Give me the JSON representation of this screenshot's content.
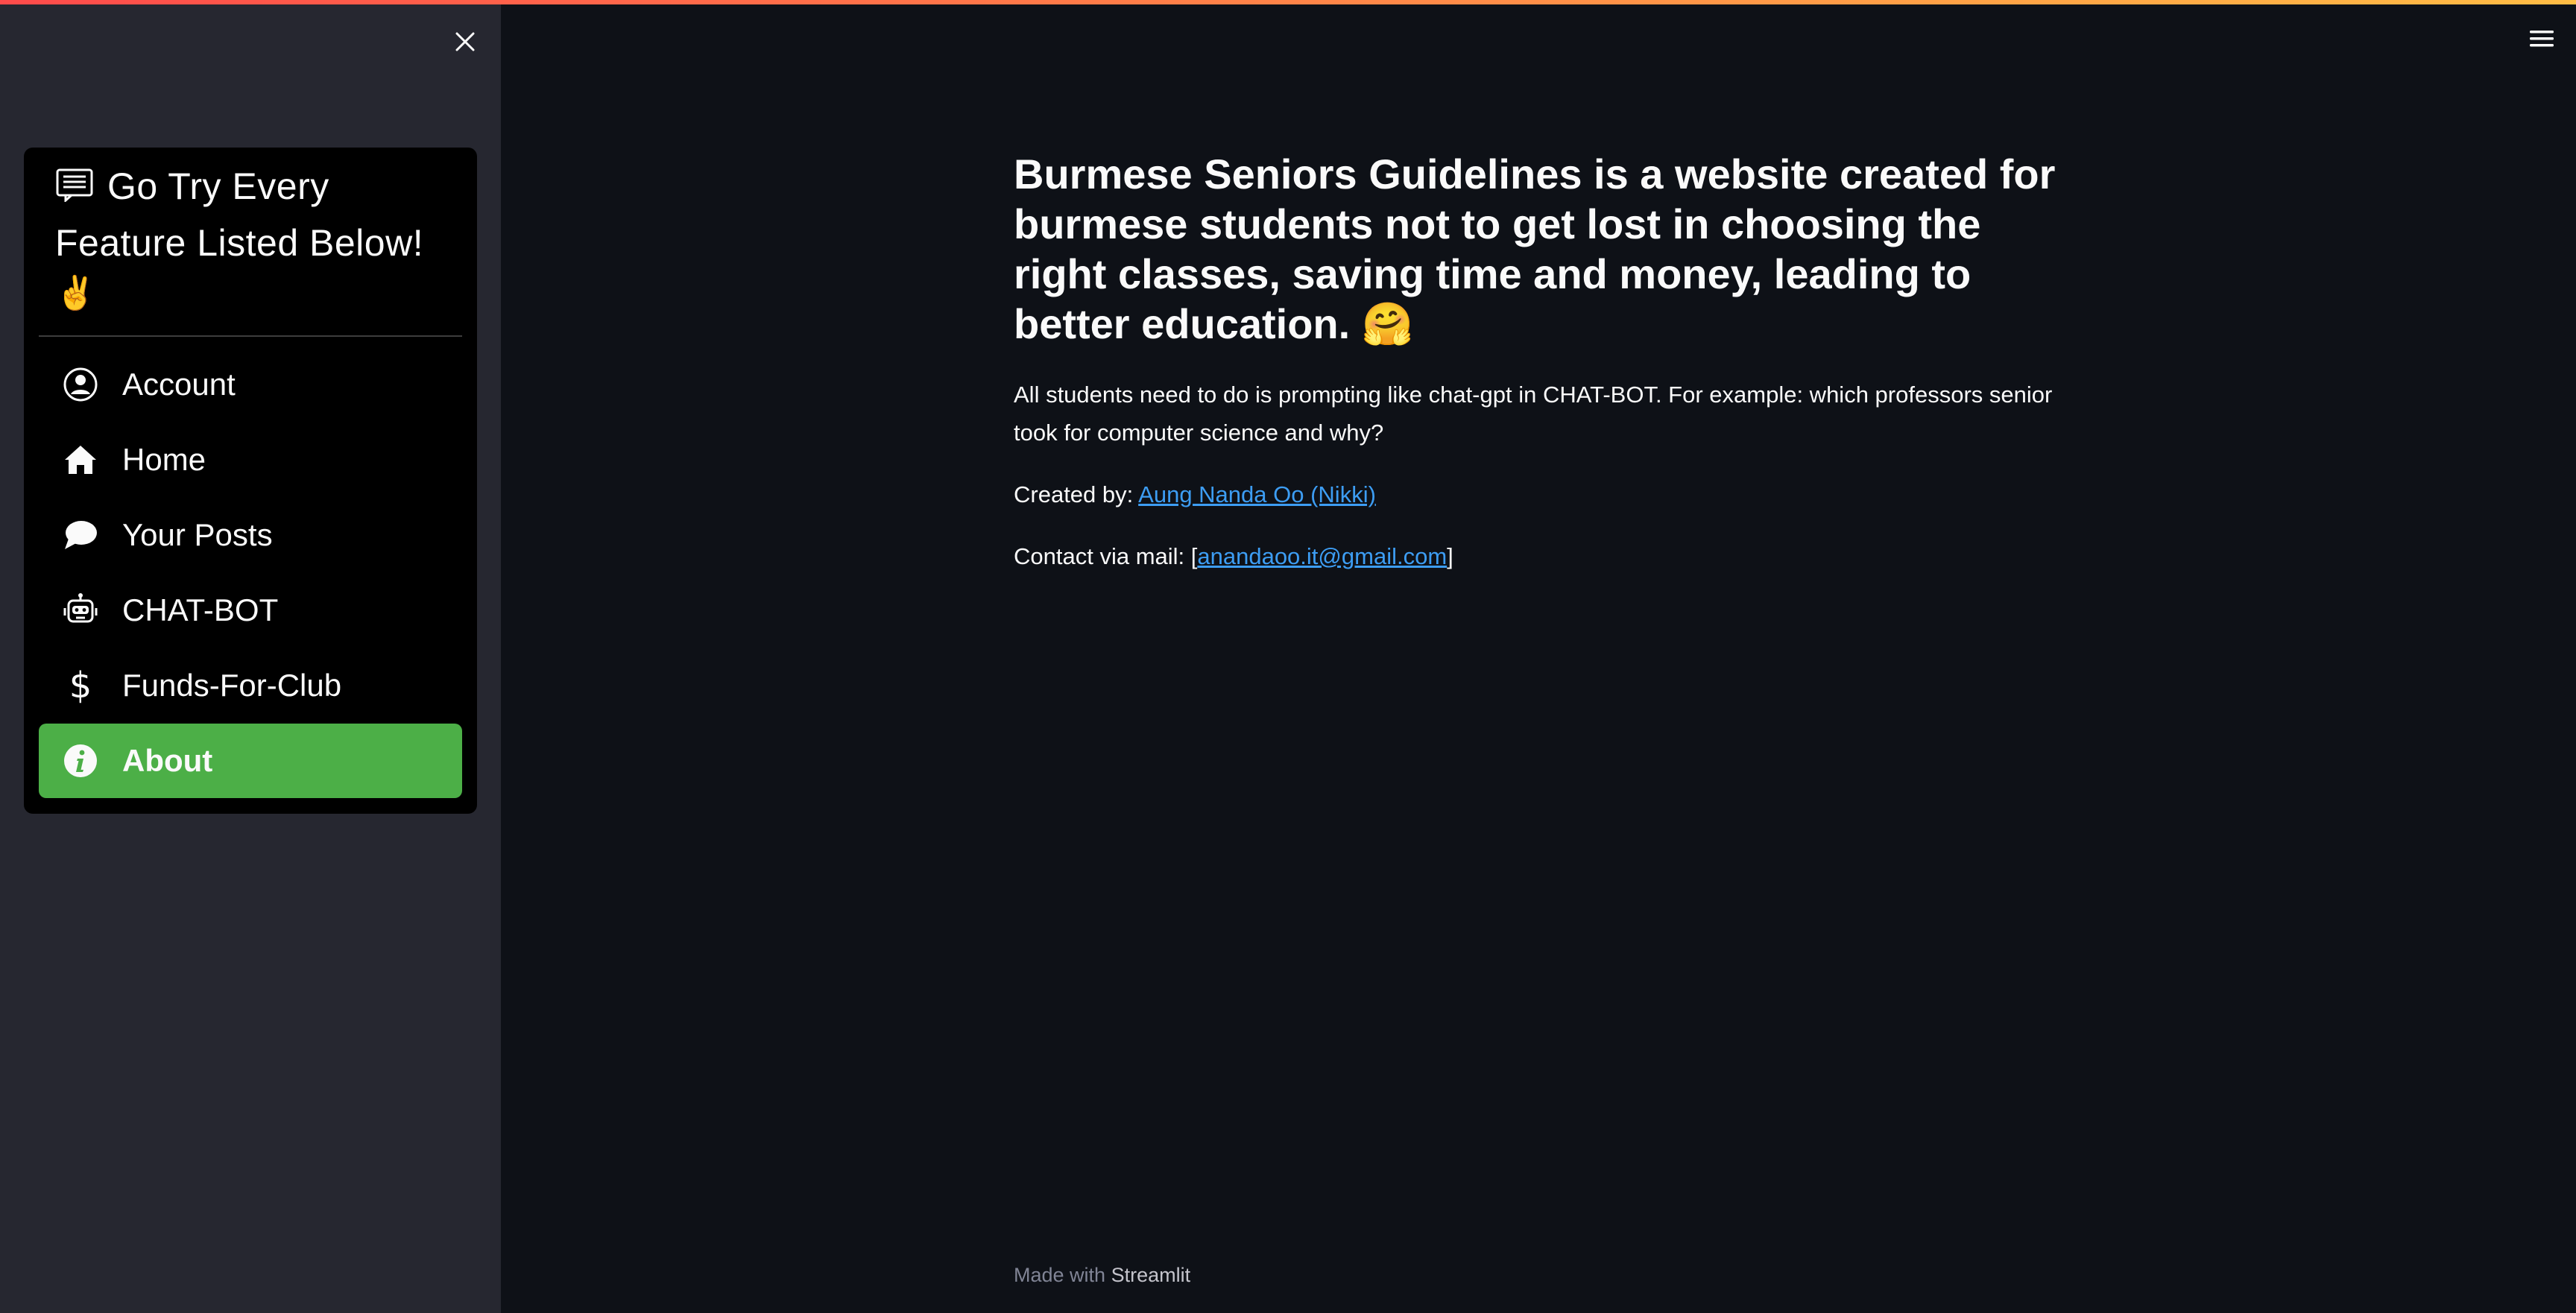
{
  "sidebar": {
    "header": {
      "title": "Go Try Every Feature Listed Below!",
      "emoji": "✌️",
      "icon": "newspaper-icon"
    },
    "close_icon": "close-icon",
    "items": [
      {
        "label": "Account",
        "icon": "person-circle-icon",
        "active": false
      },
      {
        "label": "Home",
        "icon": "house-icon",
        "active": false
      },
      {
        "label": "Your Posts",
        "icon": "chat-bubble-icon",
        "active": false
      },
      {
        "label": "CHAT-BOT",
        "icon": "robot-icon",
        "active": false
      },
      {
        "label": "Funds-For-Club",
        "icon": "dollar-icon",
        "active": false
      },
      {
        "label": "About",
        "icon": "info-circle-icon",
        "active": true
      }
    ]
  },
  "main": {
    "menu_icon": "hamburger-icon",
    "headline": "Burmese Seniors Guidelines is a website created for burmese students not to get lost in choosing the right classes, saving time and money, leading to better education. 🤗",
    "intro": "All students need to do is prompting like chat-gpt in CHAT-BOT. For example: which professors senior took for computer science and why?",
    "created_by_label": "Created by: ",
    "created_by_name": "Aung Nanda Oo (Nikki)",
    "contact_label": "Contact via mail: [",
    "contact_email": "anandaoo.it@gmail.com",
    "contact_suffix": "]"
  },
  "footer": {
    "prefix": "Made with ",
    "brand": "Streamlit"
  },
  "colors": {
    "app_background": "#0e1117",
    "sidebar_background": "#262730",
    "nav_background": "#000000",
    "active_item": "#4caf47",
    "link": "#3d9df3",
    "text": "#fafafa"
  }
}
